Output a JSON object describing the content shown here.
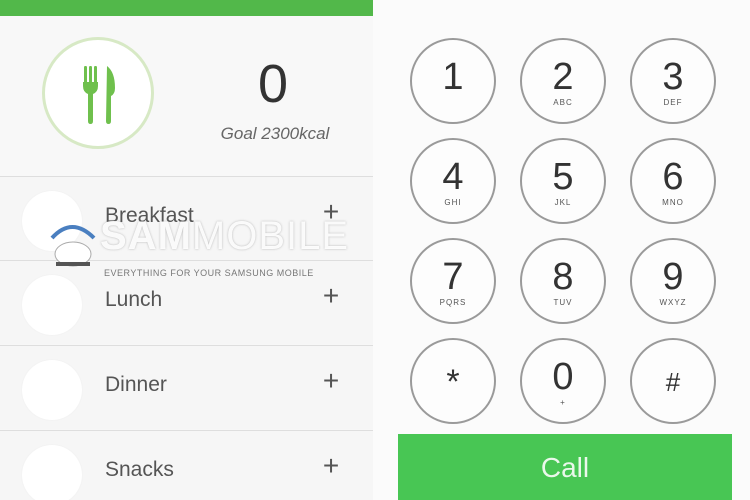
{
  "food_tracker": {
    "header": {
      "title": ""
    },
    "calories": {
      "value": "0",
      "goal": "Goal 2300kcal"
    },
    "icon": "fork-knife-icon",
    "meals": [
      {
        "label": "Breakfast",
        "add": "+"
      },
      {
        "label": "Lunch",
        "add": "+"
      },
      {
        "label": "Dinner",
        "add": "+"
      },
      {
        "label": "Snacks",
        "add": "+"
      }
    ],
    "watermark": {
      "brand_bold": "SAM",
      "brand_light": "MOBILE",
      "tagline": "EVERYTHING FOR YOUR SAMSUNG MOBILE"
    }
  },
  "dialer": {
    "keys": [
      {
        "digit": "1",
        "letters": ""
      },
      {
        "digit": "2",
        "letters": "ABC"
      },
      {
        "digit": "3",
        "letters": "DEF"
      },
      {
        "digit": "4",
        "letters": "GHI"
      },
      {
        "digit": "5",
        "letters": "JKL"
      },
      {
        "digit": "6",
        "letters": "MNO"
      },
      {
        "digit": "7",
        "letters": "PQRS"
      },
      {
        "digit": "8",
        "letters": "TUV"
      },
      {
        "digit": "9",
        "letters": "WXYZ"
      },
      {
        "digit": "*",
        "letters": ""
      },
      {
        "digit": "0",
        "letters": "+"
      },
      {
        "digit": "#",
        "letters": ""
      }
    ],
    "call_label": "Call"
  },
  "colors": {
    "accent_green": "#52b84a",
    "call_green": "#48c654",
    "icon_green": "#6fc04d"
  }
}
